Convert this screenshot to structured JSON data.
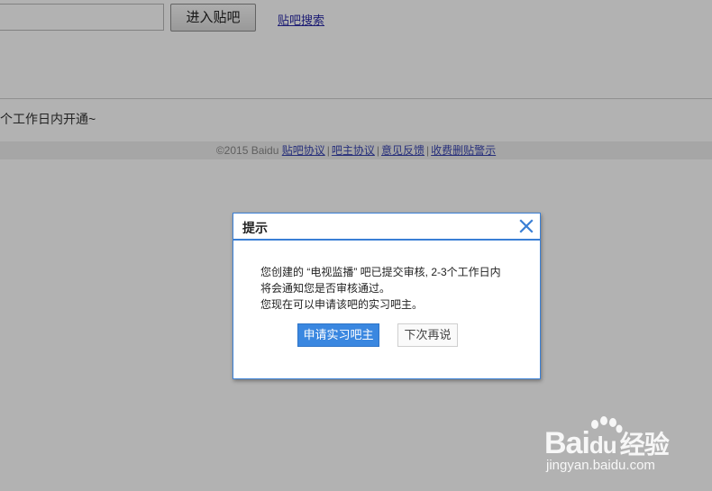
{
  "header": {
    "search_placeholder": "",
    "enter_button": "进入贴吧",
    "search_link": "贴吧搜索"
  },
  "notice": {
    "text": "个工作日内开通~"
  },
  "footer": {
    "copyright": "©2015 Baidu",
    "links": [
      "贴吧协议",
      "吧主协议",
      "意见反馈",
      "收费删贴警示"
    ],
    "separator": "|"
  },
  "dialog": {
    "title": "提示",
    "lines": [
      "您创建的 “电视监播” 吧已提交审核, 2-3个工作日内",
      "将会通知您是否审核通过。",
      "您现在可以申请该吧的实习吧主。"
    ],
    "primary_button": "申请实习吧主",
    "secondary_button": "下次再说",
    "close_icon": "close-icon"
  },
  "watermark": {
    "brand": "Bai  经验",
    "brand_du": "du",
    "url": "jingyan.baidu.com",
    "icon": "paw-icon"
  },
  "colors": {
    "accent": "#3a7fd5",
    "primary_button": "#3a87e0",
    "link": "#2a2aa6",
    "overlay": "rgba(0,0,0,0.30)"
  }
}
